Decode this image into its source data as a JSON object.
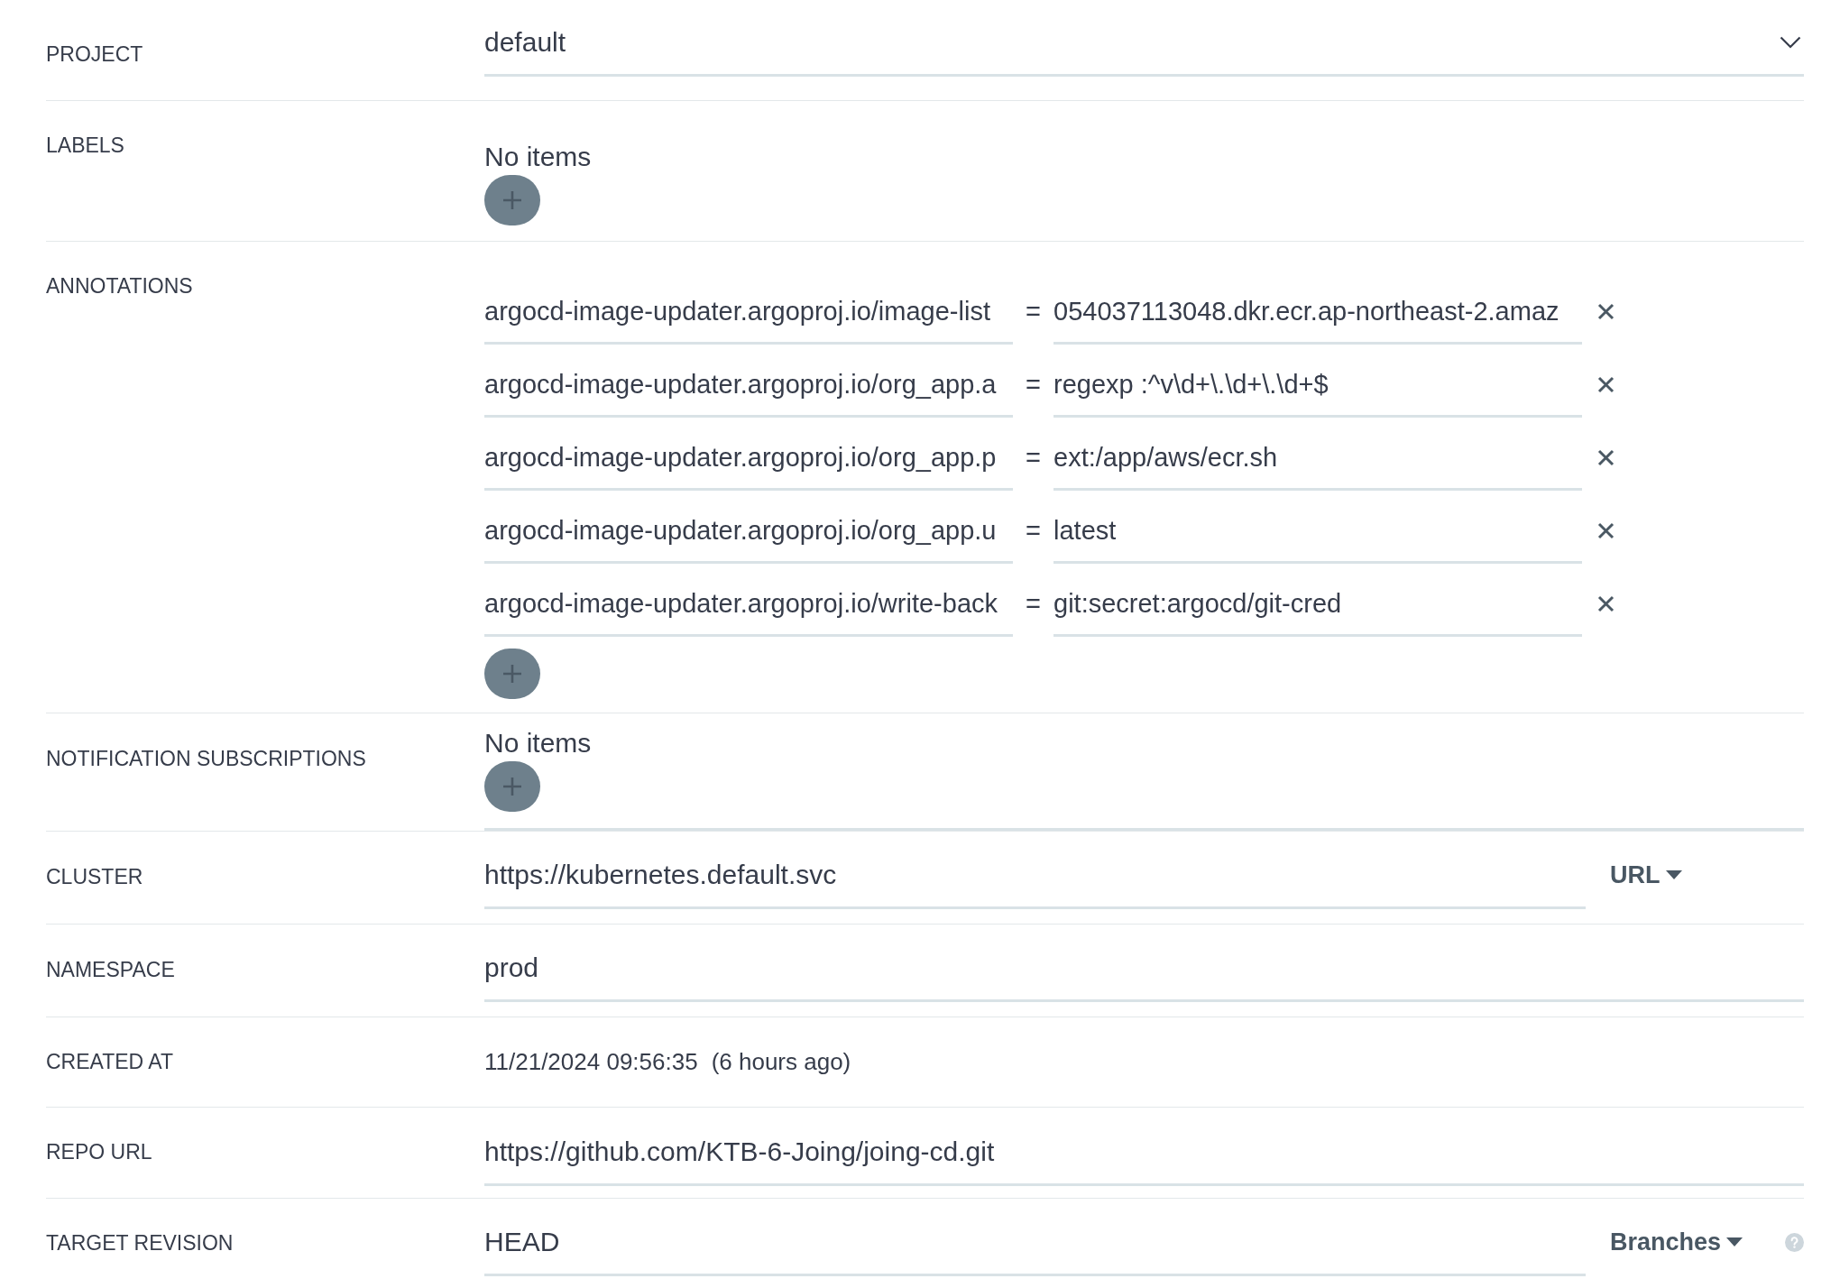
{
  "fields": [
    {
      "kind": "select",
      "label": "PROJECT",
      "value": "default"
    },
    {
      "kind": "map",
      "label": "LABELS",
      "empty_text": "No items"
    },
    {
      "kind": "map",
      "label": "ANNOTATIONS",
      "entries": [
        {
          "key": "argocd-image-updater.argoproj.io/image-list",
          "separator": "=",
          "value": "054037113048.dkr.ecr.ap-northeast-2.amaz"
        },
        {
          "key": "argocd-image-updater.argoproj.io/org_app.a",
          "separator": "=",
          "value": "regexp :^v\\d+\\.\\d+\\.\\d+$"
        },
        {
          "key": "argocd-image-updater.argoproj.io/org_app.p",
          "separator": "=",
          "value": "ext:/app/aws/ecr.sh"
        },
        {
          "key": "argocd-image-updater.argoproj.io/org_app.u",
          "separator": "=",
          "value": "latest"
        },
        {
          "key": "argocd-image-updater.argoproj.io/write-back",
          "separator": "=",
          "value": "git:secret:argocd/git-cred"
        }
      ]
    },
    {
      "kind": "map",
      "label": "NOTIFICATION SUBSCRIPTIONS",
      "empty_text": "No items"
    },
    {
      "kind": "typed_input",
      "label": "CLUSTER",
      "value": "https://kubernetes.default.svc",
      "type_selector": "URL"
    },
    {
      "kind": "input",
      "label": "NAMESPACE",
      "value": "prod"
    },
    {
      "kind": "timestamp",
      "label": "CREATED AT",
      "date": "11/21/2024 09:56:35",
      "relative": "(6 hours ago)"
    },
    {
      "kind": "input",
      "label": "REPO URL",
      "value": "https://github.com/KTB-6-Joing/joing-cd.git"
    },
    {
      "kind": "typed_input",
      "label": "TARGET REVISION",
      "value": "HEAD",
      "type_selector": "Branches",
      "help": true
    }
  ]
}
